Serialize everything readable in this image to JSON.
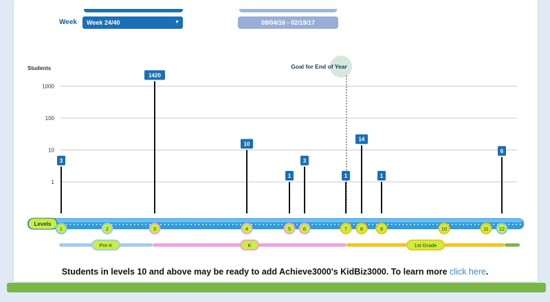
{
  "header": {
    "week_label": "Week",
    "week_selected": "Week 24/40",
    "date_range": "09/04/16 - 02/19/17"
  },
  "colors": {
    "primary_blue": "#1a6fb5",
    "level_green": "#c9f03c",
    "prek_blue": "#9ecbf2",
    "k_pink": "#f29fd6",
    "first_grade_yellow": "#f5c21a",
    "footer_green": "#7ab648",
    "link_blue": "#3a86c8"
  },
  "chart_data": {
    "type": "bar",
    "ylabel": "Students",
    "yscale": "log",
    "yticks": [
      1,
      10,
      100,
      1000
    ],
    "ylim": [
      0.1,
      5000
    ],
    "levels_label": "Levels",
    "levels": [
      "1",
      "2",
      "3",
      "4",
      "5",
      "6",
      "7",
      "8",
      "9",
      "10",
      "11",
      "12"
    ],
    "bars": [
      {
        "level": "1",
        "value": 3
      },
      {
        "level": "3",
        "value": 1420
      },
      {
        "level": "4",
        "value": 10
      },
      {
        "level": "5",
        "value": 1
      },
      {
        "level": "6",
        "value": 3
      },
      {
        "level": "7",
        "value": 1
      },
      {
        "level": "8",
        "value": 14
      },
      {
        "level": "9",
        "value": 1
      },
      {
        "level": "12",
        "value": 6
      }
    ],
    "grades": [
      "Pre-K",
      "K",
      "1st Grade"
    ],
    "goal_label": "Goal for End of Year",
    "goal_level": "7"
  },
  "footer": {
    "message": "Students in levels 10 and above may be ready to add Achieve3000's KidBiz3000. To learn more ",
    "link_text": "click here",
    "period": "."
  }
}
